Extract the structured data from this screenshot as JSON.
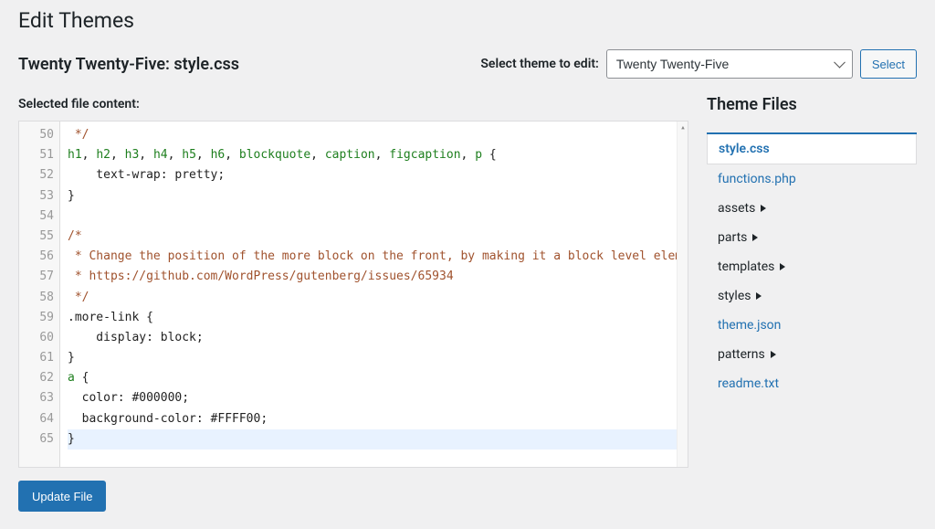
{
  "page": {
    "title": "Edit Themes",
    "subheading": "Twenty Twenty-Five: style.css",
    "selected_file_label": "Selected file content:"
  },
  "theme_picker": {
    "label": "Select theme to edit:",
    "selected": "Twenty Twenty-Five",
    "select_button": "Select"
  },
  "sidebar": {
    "title": "Theme Files",
    "items": [
      {
        "label": "style.css",
        "type": "file",
        "active": true
      },
      {
        "label": "functions.php",
        "type": "file"
      },
      {
        "label": "assets",
        "type": "folder"
      },
      {
        "label": "parts",
        "type": "folder"
      },
      {
        "label": "templates",
        "type": "folder"
      },
      {
        "label": "styles",
        "type": "folder"
      },
      {
        "label": "theme.json",
        "type": "file"
      },
      {
        "label": "patterns",
        "type": "folder"
      },
      {
        "label": "readme.txt",
        "type": "file"
      }
    ]
  },
  "editor": {
    "first_line_number": 50,
    "lines": [
      {
        "n": 50,
        "tokens": [
          {
            "t": " */",
            "c": "comment"
          }
        ]
      },
      {
        "n": 51,
        "tokens": [
          {
            "t": "h1",
            "c": "tag"
          },
          {
            "t": ", ",
            "c": "punct"
          },
          {
            "t": "h2",
            "c": "tag"
          },
          {
            "t": ", ",
            "c": "punct"
          },
          {
            "t": "h3",
            "c": "tag"
          },
          {
            "t": ", ",
            "c": "punct"
          },
          {
            "t": "h4",
            "c": "tag"
          },
          {
            "t": ", ",
            "c": "punct"
          },
          {
            "t": "h5",
            "c": "tag"
          },
          {
            "t": ", ",
            "c": "punct"
          },
          {
            "t": "h6",
            "c": "tag"
          },
          {
            "t": ", ",
            "c": "punct"
          },
          {
            "t": "blockquote",
            "c": "tag"
          },
          {
            "t": ", ",
            "c": "punct"
          },
          {
            "t": "caption",
            "c": "tag"
          },
          {
            "t": ", ",
            "c": "punct"
          },
          {
            "t": "figcaption",
            "c": "tag"
          },
          {
            "t": ", ",
            "c": "punct"
          },
          {
            "t": "p",
            "c": "tag"
          },
          {
            "t": " {",
            "c": "punct"
          }
        ]
      },
      {
        "n": 52,
        "tokens": [
          {
            "t": "    text-wrap",
            "c": "prop"
          },
          {
            "t": ": ",
            "c": "punct"
          },
          {
            "t": "pretty",
            "c": "val"
          },
          {
            "t": ";",
            "c": "punct"
          }
        ]
      },
      {
        "n": 53,
        "tokens": [
          {
            "t": "}",
            "c": "punct"
          }
        ]
      },
      {
        "n": 54,
        "tokens": [
          {
            "t": "",
            "c": "punct"
          }
        ]
      },
      {
        "n": 55,
        "tokens": [
          {
            "t": "/*",
            "c": "comment"
          }
        ]
      },
      {
        "n": 56,
        "tokens": [
          {
            "t": " * Change the position of the more block on the front, by making it a block level element.",
            "c": "comment"
          }
        ]
      },
      {
        "n": 57,
        "tokens": [
          {
            "t": " * https://github.com/WordPress/gutenberg/issues/65934",
            "c": "comment"
          }
        ]
      },
      {
        "n": 58,
        "tokens": [
          {
            "t": " */",
            "c": "comment"
          }
        ]
      },
      {
        "n": 59,
        "tokens": [
          {
            "t": ".more-link",
            "c": "selclass"
          },
          {
            "t": " {",
            "c": "punct"
          }
        ]
      },
      {
        "n": 60,
        "tokens": [
          {
            "t": "    display",
            "c": "prop"
          },
          {
            "t": ": ",
            "c": "punct"
          },
          {
            "t": "block",
            "c": "val"
          },
          {
            "t": ";",
            "c": "punct"
          }
        ]
      },
      {
        "n": 61,
        "tokens": [
          {
            "t": "}",
            "c": "punct"
          }
        ]
      },
      {
        "n": 62,
        "tokens": [
          {
            "t": "a",
            "c": "tag"
          },
          {
            "t": " {",
            "c": "punct"
          }
        ]
      },
      {
        "n": 63,
        "tokens": [
          {
            "t": "  color",
            "c": "prop"
          },
          {
            "t": ": ",
            "c": "punct"
          },
          {
            "t": "#000000",
            "c": "val"
          },
          {
            "t": ";",
            "c": "punct"
          }
        ]
      },
      {
        "n": 64,
        "tokens": [
          {
            "t": "  background-color",
            "c": "prop"
          },
          {
            "t": ": ",
            "c": "punct"
          },
          {
            "t": "#FFFF00",
            "c": "val"
          },
          {
            "t": ";",
            "c": "punct"
          }
        ]
      },
      {
        "n": 65,
        "tokens": [
          {
            "t": "}",
            "c": "punct"
          }
        ],
        "active": true
      }
    ]
  },
  "footer": {
    "update_button": "Update File"
  }
}
